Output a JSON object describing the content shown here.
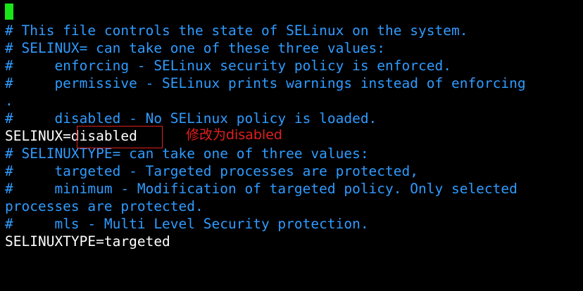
{
  "terminal": {
    "colors": {
      "background": "#000000",
      "comment": "#2f9bff",
      "config": "#ffffff",
      "cursor": "#19e619",
      "annotation": "#e0201e"
    },
    "lines": [
      "# This file controls the state of SELinux on the system.",
      "# SELINUX= can take one of these three values:",
      "#     enforcing - SELinux security policy is enforced.",
      "#     permissive - SELinux prints warnings instead of enforcing",
      ".",
      "#     disabled - No SELinux policy is loaded.",
      "SELINUX=disabled",
      "# SELINUXTYPE= can take one of three values:",
      "#     targeted - Targeted processes are protected,",
      "#     minimum - Modification of targeted policy. Only selected",
      "processes are protected.",
      "#     mls - Multi Level Security protection.",
      "SELINUXTYPE=targeted"
    ]
  },
  "annotation": {
    "text": "修改为disabled"
  }
}
